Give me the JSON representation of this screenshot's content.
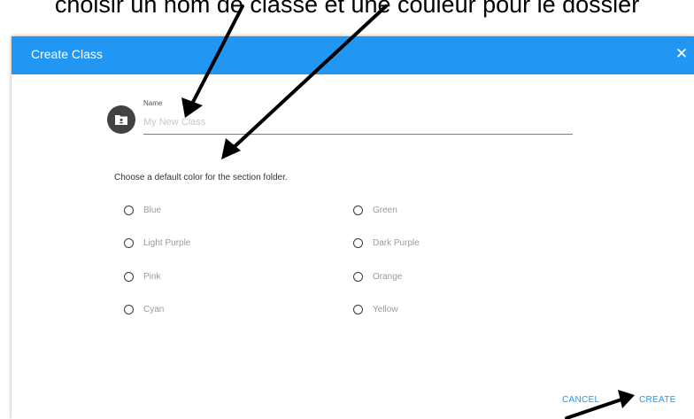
{
  "caption": "choisir un nom de classe et une couleur pour le dossier",
  "dialog": {
    "title": "Create Class",
    "close_symbol": "✕",
    "header_color": "#2196f3"
  },
  "name_field": {
    "label": "Name",
    "placeholder": "My New Class",
    "value": "",
    "icon": "folder-icon"
  },
  "color_section": {
    "prompt": "Choose a default color for the section folder.",
    "options": [
      {
        "label": "Blue",
        "selected": false
      },
      {
        "label": "Green",
        "selected": false
      },
      {
        "label": "Light Purple",
        "selected": false
      },
      {
        "label": "Dark Purple",
        "selected": false
      },
      {
        "label": "Pink",
        "selected": false
      },
      {
        "label": "Orange",
        "selected": false
      },
      {
        "label": "Cyan",
        "selected": false
      },
      {
        "label": "Yellow",
        "selected": false
      }
    ]
  },
  "actions": {
    "cancel_label": "CANCEL",
    "create_label": "CREATE",
    "accent_color": "#2196f3"
  }
}
